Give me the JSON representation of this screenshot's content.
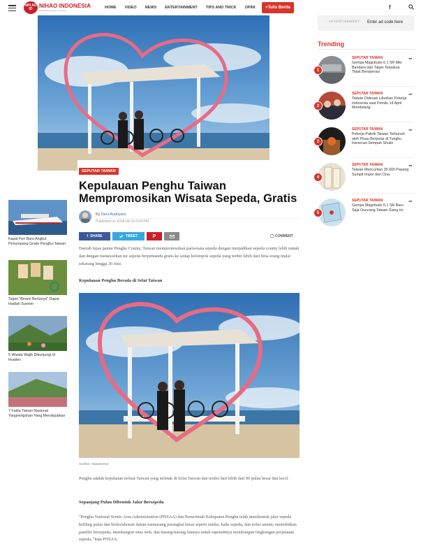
{
  "nav": {
    "logo_badge": "NIH AO ID",
    "logo_name": "NIHAO INDONESIA",
    "logo_tagline": "Indonesian News in Taiwan",
    "menu": [
      "HOME",
      "VIDEO",
      "NEWS",
      "ENTERTAINMENT",
      "TIPS AND TRICK",
      "OPINI"
    ],
    "cta": "+Tulis Berita",
    "social": "f"
  },
  "article": {
    "category": "SEPUTAR TAIWAN",
    "title": "Kepulauan Penghu Taiwan Mempromosikan Wisata Sepeda, Gratis",
    "by_prefix": "By",
    "author": "Devi Andriyani",
    "published": "Published on 2018-04-23 6:04 PM",
    "share": {
      "facebook": "SHARE",
      "twitter": "TWEET"
    },
    "comment": "COMMENT",
    "para1": "Daerah lepas pantai Penghu County, Taiwan mempromosikan pariwisata sepeda dengan menjadikan sepeda county lebih ramah dan dengan menawarkan tur sepeda berpemandu gratis ke setiap kelompok sepeda yang terdiri lebih dari lima orang mulai sekarang hingga 30 Juni.",
    "sub1": "Kepulauan Penghu Berada di Selat Taiwan",
    "caption": "Sumber: Taiwannews",
    "para2": "Penghu adalah kepulauan terluar Taiwan yang terletak di Selat Taiwan dan terdiri dari lebih dari 90 pulau besar dan kecil.",
    "sub2": "Sepanjang Pulau Dibentuk Jalur Bersepeda",
    "para3": "\"Penghu National Scenic Area Administration (PNSAA) dan Pemerintah Kabupaten Penghu telah membentuk jalur sepeda keliling pulau dan berkolaborasi dalam memasang perangkat keras seperti rambu, halte sepeda, dan toilet umum; menerbitkan pamflet bersepeda; membangun situs web, dan barang-barang lainnya untuk sepenuhnya membangun lingkungan perjalanan sepeda, \"kata PNSAA."
  },
  "related": [
    {
      "title": "Kapal Feri Baru Angkut Penumpang Gratis Penghu-Taiwan"
    },
    {
      "title": "Taipei \"Berani Bertanya\" Dapat Hadiah Suvenir"
    },
    {
      "title": "5 Wisata Wajib Dikunjungi di Hualien"
    },
    {
      "title": "7 Fakta Taman Nasional Yangmingshan Yang Menakjubkan"
    }
  ],
  "sidebar": {
    "ad_label": "- ADVERTISEMENT -",
    "ad_code": "Enter ad code here",
    "trending_title": "Trending",
    "items": [
      {
        "num": "1",
        "category": "SEPUTAR TAIWAN",
        "title": "Gempa Magnitudo 6.1 SR Mkt Bandara dan Taipei Terpaksa Tidak Beroperasi"
      },
      {
        "num": "2",
        "category": "SEPUTAR TAIWAN",
        "title": "Taiwan Didesak Liburkan Pekerja Indonesia saat Pemilu 14 April Mendatang"
      },
      {
        "num": "3",
        "category": "SEPUTAR TAIWAN",
        "title": "Pekerja Pabrik Taiwan Terbunuh oleh Pisau Berputar di Tungku Inenerasi Sempah Shulin"
      },
      {
        "num": "4",
        "category": "SEPUTAR TAIWAN",
        "title": "Taiwan Mencurkan 35.000 Pasang Sumpit Impor dari Cina"
      },
      {
        "num": "5",
        "category": "SEPUTAR TAIWAN",
        "title": "Gempa Magnitudo 6.1 SR Baru Saja Guncang Taiwan Siang Ini"
      }
    ]
  }
}
